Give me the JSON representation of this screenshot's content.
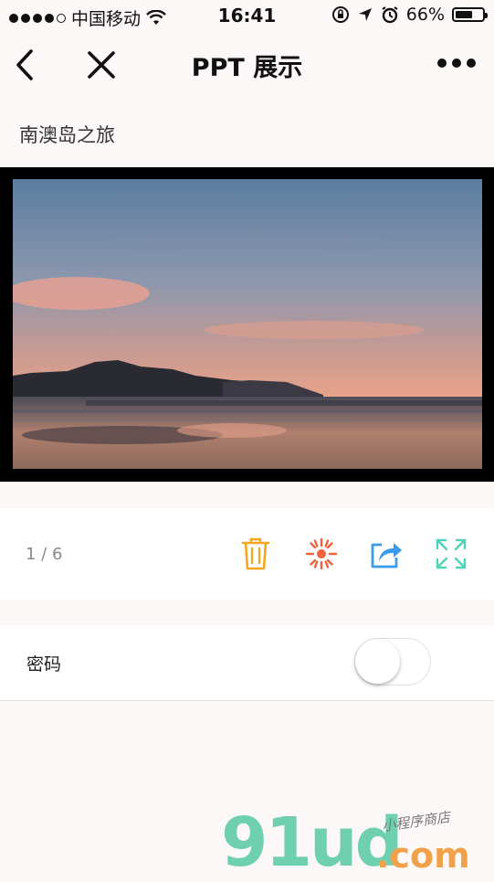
{
  "status_bar": {
    "carrier": "中国移动",
    "time": "16:41",
    "battery_text": "66%",
    "battery_level": 0.66,
    "icons": [
      "signal-dots-icon",
      "wifi-icon",
      "orientation-lock-icon",
      "location-arrow-icon",
      "alarm-icon",
      "battery-icon"
    ]
  },
  "nav": {
    "title": "PPT 展示",
    "icons": [
      "back-chevron-icon",
      "close-icon",
      "more-dots-icon"
    ]
  },
  "ppt": {
    "title": "南澳岛之旅",
    "slide_image": "sunset-beach-mountain-photo"
  },
  "toolbar": {
    "page_indicator": "1 / 6",
    "actions": [
      {
        "name": "delete",
        "icon": "trash-icon",
        "color": "#f5a623"
      },
      {
        "name": "effects",
        "icon": "burst-icon",
        "color": "#f2603d"
      },
      {
        "name": "share",
        "icon": "share-icon",
        "color": "#3a9bea"
      },
      {
        "name": "fullscreen",
        "icon": "expand-icon",
        "color": "#4ed2b8"
      }
    ]
  },
  "password": {
    "label": "密码",
    "toggle_on": false
  },
  "watermark": {
    "main": "91ud",
    "domain": ".com",
    "sub": "小程序商店"
  }
}
